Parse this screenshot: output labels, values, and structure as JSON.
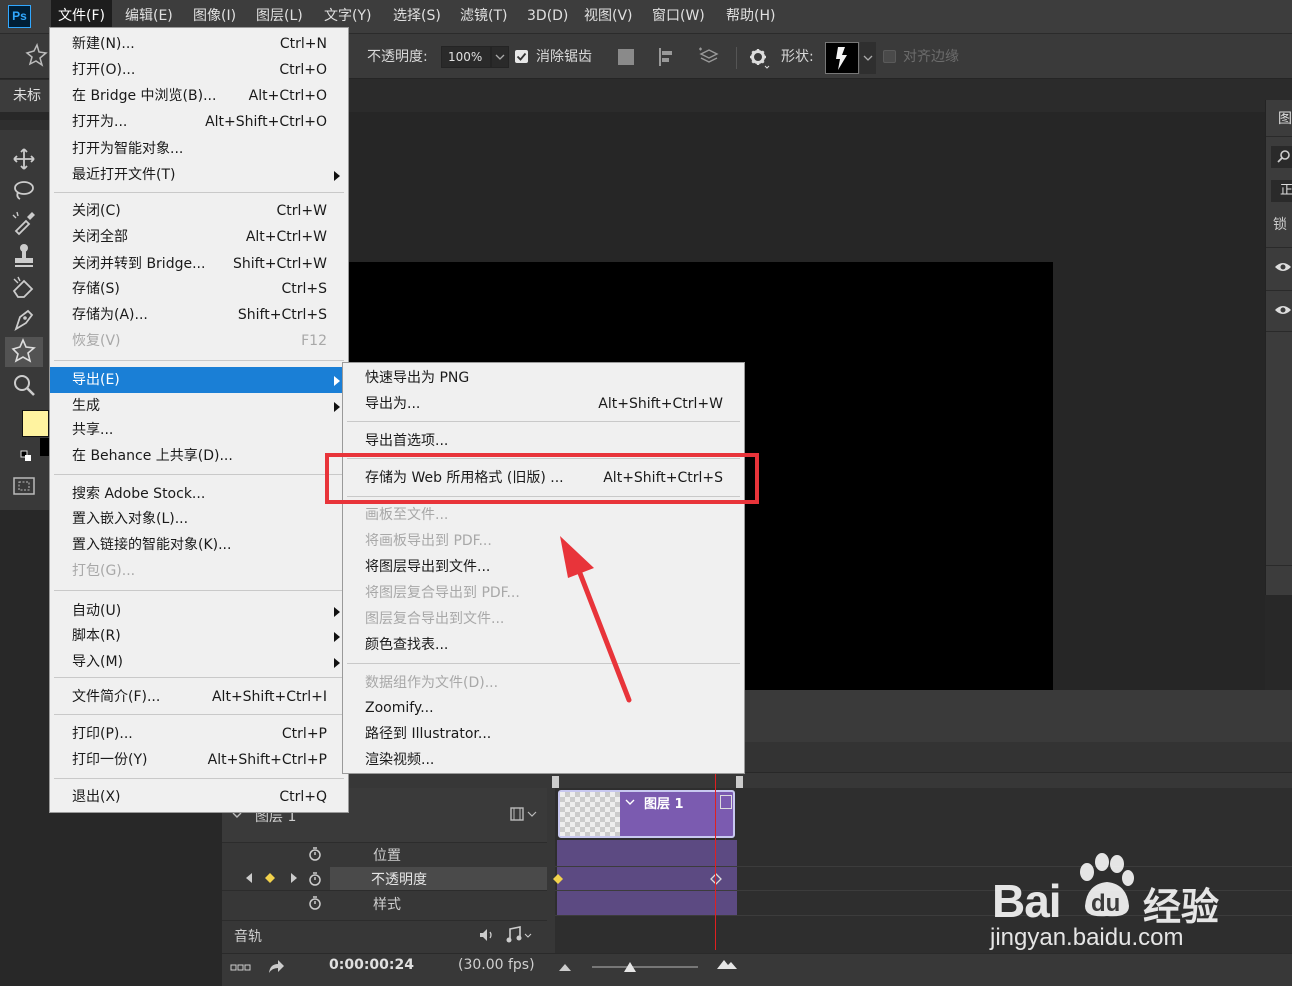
{
  "app": {
    "logo": "Ps"
  },
  "menubar": {
    "items": [
      "文件(F)",
      "编辑(E)",
      "图像(I)",
      "图层(L)",
      "文字(Y)",
      "选择(S)",
      "滤镜(T)",
      "3D(D)",
      "视图(V)",
      "窗口(W)",
      "帮助(H)"
    ]
  },
  "options": {
    "opacity_label": "不透明度:",
    "opacity_value": "100%",
    "antialias_label": "消除锯齿",
    "shape_label": "形状:",
    "align_edges_label": "对齐边缘"
  },
  "document": {
    "tab_title": "未标"
  },
  "file_menu": {
    "groups": [
      [
        {
          "label": "新建(N)...",
          "shortcut": "Ctrl+N"
        },
        {
          "label": "打开(O)...",
          "shortcut": "Ctrl+O"
        },
        {
          "label": "在 Bridge 中浏览(B)...",
          "shortcut": "Alt+Ctrl+O"
        },
        {
          "label": "打开为...",
          "shortcut": "Alt+Shift+Ctrl+O"
        },
        {
          "label": "打开为智能对象...",
          "shortcut": ""
        },
        {
          "label": "最近打开文件(T)",
          "shortcut": "",
          "submenu": true
        }
      ],
      [
        {
          "label": "关闭(C)",
          "shortcut": "Ctrl+W"
        },
        {
          "label": "关闭全部",
          "shortcut": "Alt+Ctrl+W"
        },
        {
          "label": "关闭并转到 Bridge...",
          "shortcut": "Shift+Ctrl+W"
        },
        {
          "label": "存储(S)",
          "shortcut": "Ctrl+S"
        },
        {
          "label": "存储为(A)...",
          "shortcut": "Shift+Ctrl+S"
        },
        {
          "label": "恢复(V)",
          "shortcut": "F12",
          "disabled": true
        }
      ],
      [
        {
          "label": "导出(E)",
          "shortcut": "",
          "submenu": true,
          "selected": true
        },
        {
          "label": "生成",
          "shortcut": "",
          "submenu": true
        },
        {
          "label": "共享...",
          "shortcut": ""
        },
        {
          "label": "在 Behance 上共享(D)...",
          "shortcut": ""
        }
      ],
      [
        {
          "label": "搜索 Adobe Stock...",
          "shortcut": ""
        },
        {
          "label": "置入嵌入对象(L)...",
          "shortcut": ""
        },
        {
          "label": "置入链接的智能对象(K)...",
          "shortcut": ""
        },
        {
          "label": "打包(G)...",
          "shortcut": "",
          "disabled": true
        }
      ],
      [
        {
          "label": "自动(U)",
          "shortcut": "",
          "submenu": true
        },
        {
          "label": "脚本(R)",
          "shortcut": "",
          "submenu": true
        },
        {
          "label": "导入(M)",
          "shortcut": "",
          "submenu": true
        }
      ],
      [
        {
          "label": "文件简介(F)...",
          "shortcut": "Alt+Shift+Ctrl+I"
        }
      ],
      [
        {
          "label": "打印(P)...",
          "shortcut": "Ctrl+P"
        },
        {
          "label": "打印一份(Y)",
          "shortcut": "Alt+Shift+Ctrl+P"
        }
      ],
      [
        {
          "label": "退出(X)",
          "shortcut": "Ctrl+Q"
        }
      ]
    ]
  },
  "export_submenu": {
    "groups": [
      [
        {
          "label": "快速导出为 PNG",
          "shortcut": ""
        },
        {
          "label": "导出为...",
          "shortcut": "Alt+Shift+Ctrl+W"
        }
      ],
      [
        {
          "label": "导出首选项...",
          "shortcut": ""
        }
      ],
      [
        {
          "label": "存储为 Web 所用格式 (旧版) ...",
          "shortcut": "Alt+Shift+Ctrl+S",
          "highlighted": true
        }
      ],
      [
        {
          "label": "画板至文件...",
          "shortcut": "",
          "disabled": true
        },
        {
          "label": "将画板导出到 PDF...",
          "shortcut": "",
          "disabled": true
        },
        {
          "label": "将图层导出到文件...",
          "shortcut": ""
        },
        {
          "label": "将图层复合导出到 PDF...",
          "shortcut": "",
          "disabled": true
        },
        {
          "label": "图层复合导出到文件...",
          "shortcut": "",
          "disabled": true
        },
        {
          "label": "颜色查找表...",
          "shortcut": ""
        }
      ],
      [
        {
          "label": "数据组作为文件(D)...",
          "shortcut": "",
          "disabled": true
        },
        {
          "label": "Zoomify...",
          "shortcut": ""
        },
        {
          "label": "路径到 Illustrator...",
          "shortcut": ""
        },
        {
          "label": "渲染视频...",
          "shortcut": ""
        }
      ]
    ]
  },
  "right_panel": {
    "title": "图",
    "mode": "正",
    "lock": "锁"
  },
  "timeline": {
    "layer_name": "图层 1",
    "clip_name": "图层 1",
    "properties": [
      "位置",
      "不透明度",
      "样式"
    ],
    "audio_label": "音轨",
    "timecode": "0:00:00:24",
    "fps": "(30.00 fps)"
  },
  "annotation": {
    "color": "#e8343a"
  },
  "watermark": {
    "brand": "Bai",
    "brand2": "du",
    "cn": "经验",
    "url": "jingyan.baidu.com"
  }
}
